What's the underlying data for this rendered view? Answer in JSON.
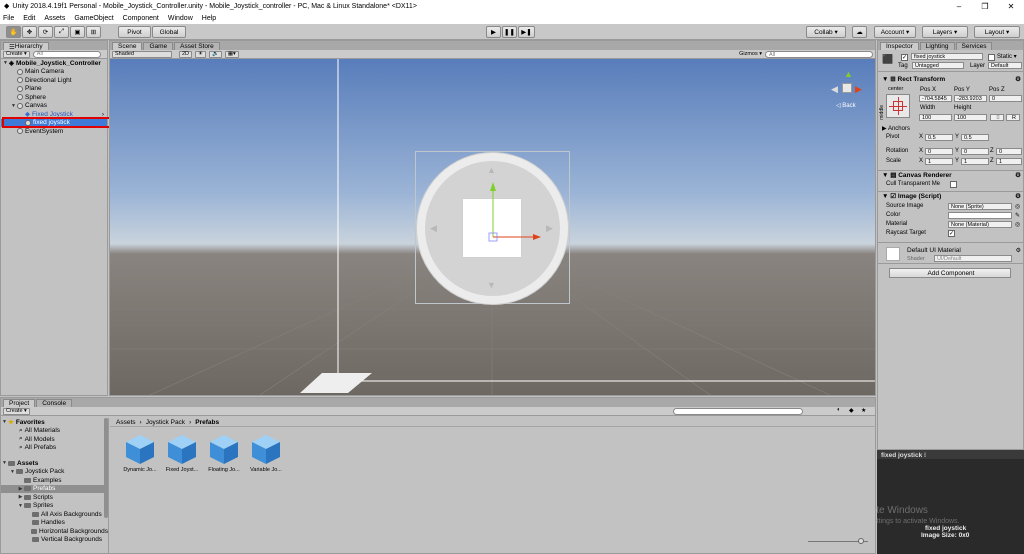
{
  "window": {
    "title": "Unity 2018.4.19f1 Personal - Mobile_Joystick_Controller.unity - Mobile_Joystick_controller - PC, Mac & Linux Standalone* <DX11>",
    "min": "–",
    "max": "❐",
    "close": "✕"
  },
  "menu": [
    "File",
    "Edit",
    "Assets",
    "GameObject",
    "Component",
    "Window",
    "Help"
  ],
  "toolbar": {
    "pivot": "Pivot",
    "global": "Global",
    "collab": "Collab ▾",
    "account": "Account ▾",
    "layers": "Layers ▾",
    "layout": "Layout ▾"
  },
  "hierarchy": {
    "tab": "Hierarchy",
    "create": "Create ▾",
    "search": "All",
    "scene": "Mobile_Joystick_Controller",
    "items": [
      {
        "label": "Main Camera",
        "depth": 1
      },
      {
        "label": "Directional Light",
        "depth": 1
      },
      {
        "label": "Plane",
        "depth": 1
      },
      {
        "label": "Sphere",
        "depth": 1
      },
      {
        "label": "Canvas",
        "depth": 1,
        "expanded": true
      },
      {
        "label": "Fixed Joystick",
        "depth": 2,
        "prefab": true
      },
      {
        "label": "fixed joystick",
        "depth": 2,
        "selected": true
      },
      {
        "label": "EventSystem",
        "depth": 1
      }
    ]
  },
  "scene": {
    "tabs": [
      "Scene",
      "Game",
      "Asset Store"
    ],
    "shaded": "Shaded",
    "mode2d": "2D",
    "gizmos": "Gizmos ▾",
    "search": "All",
    "gizmo_label": "◁ Back"
  },
  "inspector": {
    "tabs": [
      "Inspector",
      "Lighting",
      "Services"
    ],
    "object_name": "fixed joystick",
    "static": "Static ▾",
    "tag_label": "Tag",
    "tag": "Untagged",
    "layer_label": "Layer",
    "layer": "Default",
    "rect_transform": "Rect Transform",
    "anchor_preset": "center",
    "side_label": "middle",
    "pos_labels": [
      "Pos X",
      "Pos Y",
      "Pos Z"
    ],
    "pos_values": [
      "-704.5845",
      "-283.9203",
      "0"
    ],
    "width_label": "Width",
    "height_label": "Height",
    "width": "100",
    "height": "100",
    "anchors": "Anchors",
    "pivot_label": "Pivot",
    "pivot": [
      "0.5",
      "0.5"
    ],
    "rotation_label": "Rotation",
    "rotation": [
      "0",
      "0",
      "0"
    ],
    "scale_label": "Scale",
    "scale": [
      "1",
      "1",
      "1"
    ],
    "canvas_renderer": "Canvas Renderer",
    "cull": "Cull Transparent Me",
    "image_script": "Image (Script)",
    "source_image_label": "Source Image",
    "source_image": "None (Sprite)",
    "color_label": "Color",
    "material_label": "Material",
    "material": "None (Material)",
    "raycast_label": "Raycast Target",
    "mat_name": "Default UI Material",
    "shader_label": "Shader",
    "shader": "UI/Default",
    "add_component": "Add Component"
  },
  "preview": {
    "header": "fixed joystick ⁝",
    "watermark1": "Activate Windows",
    "watermark2": "Go to Settings to activate Windows.",
    "name": "fixed joystick",
    "size": "Image Size: 0x0"
  },
  "project": {
    "tabs": [
      "Project",
      "Console"
    ],
    "create": "Create ▾",
    "favorites": "Favorites",
    "fav_items": [
      "All Materials",
      "All Models",
      "All Prefabs"
    ],
    "assets": "Assets",
    "tree": [
      {
        "label": "Joystick Pack",
        "depth": 1
      },
      {
        "label": "Examples",
        "depth": 2
      },
      {
        "label": "Prefabs",
        "depth": 2,
        "selected": true
      },
      {
        "label": "Scripts",
        "depth": 2
      },
      {
        "label": "Sprites",
        "depth": 2
      },
      {
        "label": "All Axis Backgrounds",
        "depth": 3
      },
      {
        "label": "Handles",
        "depth": 3
      },
      {
        "label": "Horizontal Backgrounds",
        "depth": 3
      },
      {
        "label": "Vertical Backgrounds",
        "depth": 3
      }
    ],
    "breadcrumb": [
      "Assets",
      "Joystick Pack",
      "Prefabs"
    ],
    "assets_grid": [
      "Dynamic Jo...",
      "Fixed Joyst...",
      "Floating Jo...",
      "Variable Jo..."
    ]
  },
  "colors": {
    "selection": "#3e7ad6",
    "highlight_box": "#e00000"
  }
}
